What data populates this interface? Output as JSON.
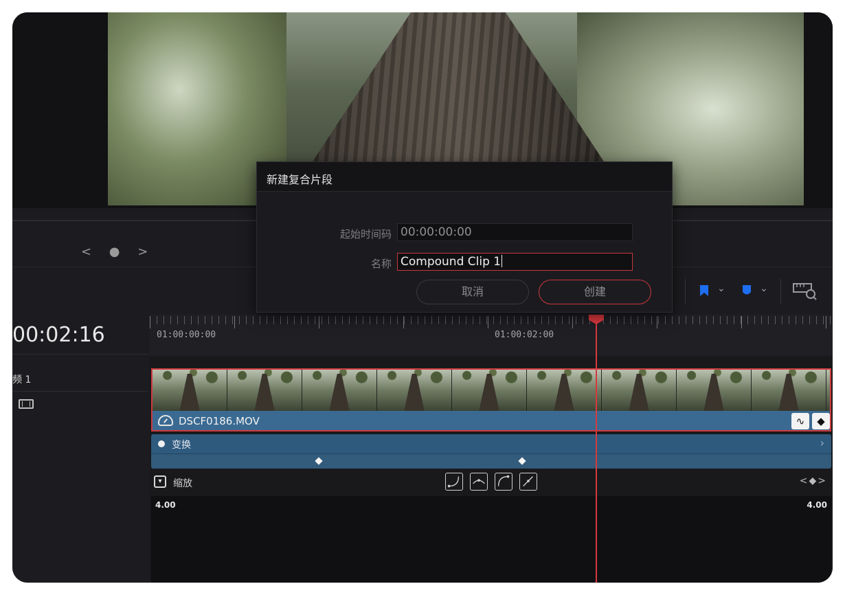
{
  "dialog": {
    "title": "新建复合片段",
    "start_timecode_label": "起始时间码",
    "start_timecode_value": "00:00:00:00",
    "name_label": "名称",
    "name_value": "Compound Clip 1",
    "cancel_label": "取消",
    "create_label": "创建"
  },
  "nav": {
    "pager": "< ● >"
  },
  "timeline": {
    "timecode": "00:02:16",
    "ruler_labels": [
      "01:00:00:00",
      "01:00:02:00"
    ],
    "track_label": "频 1",
    "clip_name": "DSCF0186.MOV",
    "fx_label": "变换",
    "scale_label": "缩放",
    "graph_value_left": "4.00",
    "graph_value_right": "4.00",
    "kf_nav": "<◆>"
  },
  "colors": {
    "accent_red": "#d03a3f",
    "clip_blue": "#3a6a92",
    "marker_blue": "#1d6ef0"
  },
  "icons": [
    "flag-marker-icon",
    "chevron-down-icon",
    "shield-marker-icon",
    "zoom-ruler-icon",
    "film-icon",
    "speed-icon",
    "curve-icon",
    "keyframe-icon",
    "dropdown-icon",
    "ease-in-icon",
    "ease-both-icon",
    "ease-out-icon",
    "linear-icon"
  ]
}
